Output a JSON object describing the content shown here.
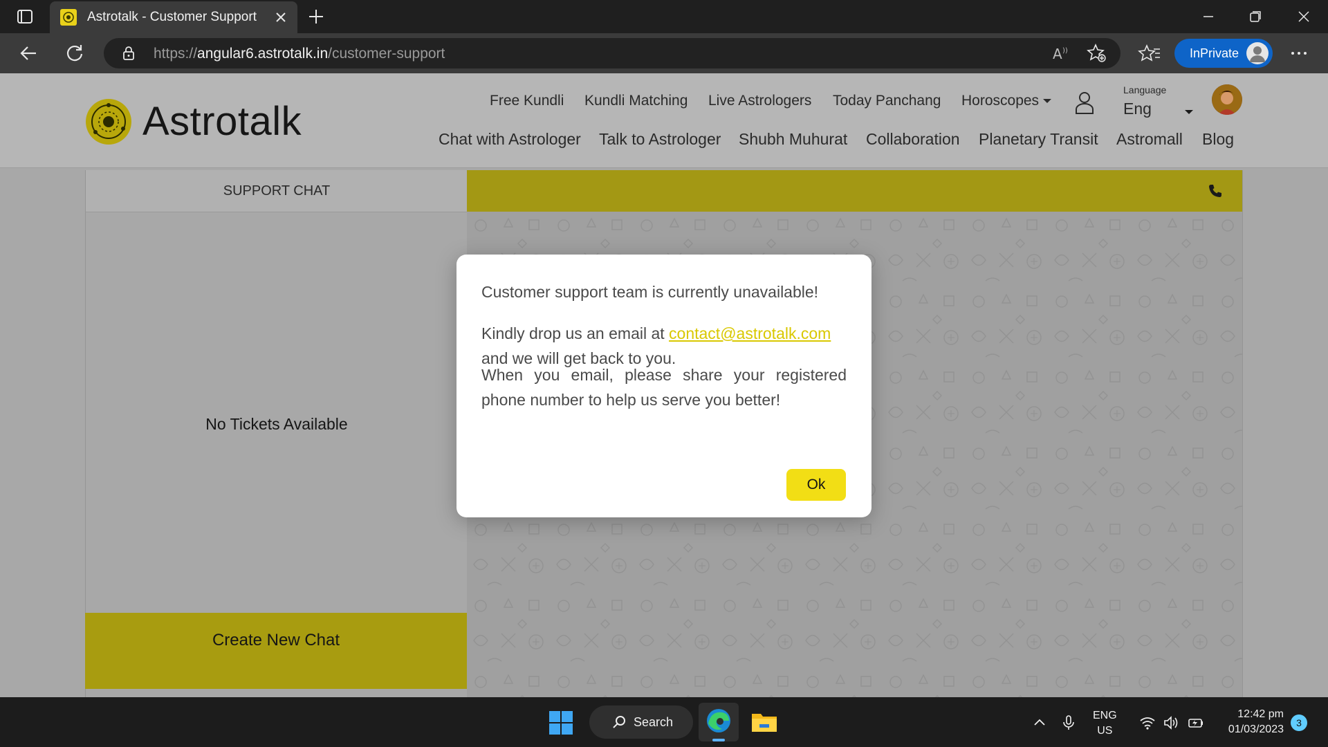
{
  "browser": {
    "tab_title": "Astrotalk - Customer Support",
    "url_scheme": "https://",
    "url_host": "angular6.astrotalk.in",
    "url_path": "/customer-support",
    "inprivate_label": "InPrivate"
  },
  "site": {
    "logo_text": "Astrotalk",
    "nav_top": [
      "Free Kundli",
      "Kundli Matching",
      "Live Astrologers",
      "Today Panchang",
      "Horoscopes"
    ],
    "nav_bottom": [
      "Chat with Astrologer",
      "Talk to Astrologer",
      "Shubh Muhurat",
      "Collaboration",
      "Planetary Transit",
      "Astromall",
      "Blog"
    ],
    "language_caption": "Language",
    "language_value": "Eng",
    "brand_color": "#f2de15"
  },
  "chat": {
    "support_chat_title": "SUPPORT CHAT",
    "empty_text": "No Tickets Available",
    "create_button": "Create New Chat"
  },
  "modal": {
    "line1": "Customer support team is currently unavailable!",
    "line2_prefix": "Kindly drop us an email at ",
    "email": "contact@astrotalk.com",
    "line2_suffix": " and we will get back to you.",
    "line3": "When you email, please share your registered phone number to help us serve you better!",
    "ok_label": "Ok"
  },
  "taskbar": {
    "search_label": "Search",
    "lang_line1": "ENG",
    "lang_line2": "US",
    "time": "12:42 pm",
    "date": "01/03/2023",
    "notification_count": "3"
  }
}
